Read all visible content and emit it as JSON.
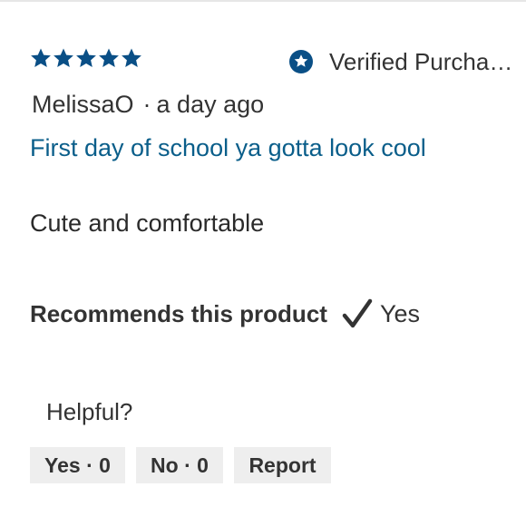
{
  "rating": {
    "stars_filled": 5,
    "stars_total": 5,
    "star_color": "#0a4f86"
  },
  "verified": {
    "label": "Verified Purcha…",
    "icon": "verified-badge-icon",
    "color": "#0a4f86"
  },
  "review": {
    "author": "MelissaO",
    "separator": "·",
    "time": "a day ago",
    "title": "First day of school ya gotta look cool",
    "title_color": "#0a5e8a",
    "body": "Cute and comfortable"
  },
  "recommendation": {
    "label": "Recommends this product",
    "icon": "checkmark-icon",
    "value": "Yes"
  },
  "feedback": {
    "prompt": "Helpful?",
    "yes_label": "Yes · 0",
    "no_label": "No · 0",
    "report_label": "Report"
  }
}
